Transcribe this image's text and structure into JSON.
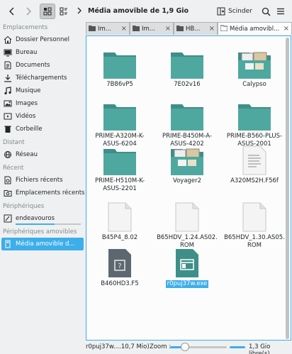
{
  "toolbar": {
    "back_icon": "chevron-left",
    "forward_icon": "chevron-right",
    "breadcrumb": "Média amovible de 1,9 Gio",
    "split_label": "Scinder"
  },
  "sidebar": {
    "sections": {
      "places": "Emplacements",
      "remote": "Distant",
      "recent": "Récent",
      "devices": "Périphériques",
      "removable": "Périphériques amovibles"
    },
    "places": [
      {
        "label": "Dossier Personnel",
        "icon": "home-icon"
      },
      {
        "label": "Bureau",
        "icon": "desktop-icon"
      },
      {
        "label": "Documents",
        "icon": "documents-icon"
      },
      {
        "label": "Téléchargements",
        "icon": "download-icon"
      },
      {
        "label": "Musique",
        "icon": "music-icon"
      },
      {
        "label": "Images",
        "icon": "images-icon"
      },
      {
        "label": "Vidéos",
        "icon": "video-icon"
      },
      {
        "label": "Corbeille",
        "icon": "trash-icon"
      }
    ],
    "remote": [
      {
        "label": "Réseau",
        "icon": "network-icon"
      }
    ],
    "recent": [
      {
        "label": "Fichiers récents",
        "icon": "recent-files-icon"
      },
      {
        "label": "Emplacements récents",
        "icon": "recent-places-icon"
      }
    ],
    "devices": [
      {
        "label": "endeavouros",
        "icon": "drive-icon"
      }
    ],
    "removable": [
      {
        "label": "Média amovible d...",
        "icon": "usb-drive-icon"
      }
    ]
  },
  "tabs": [
    {
      "label": "Im..."
    },
    {
      "label": "Im..."
    },
    {
      "label": "HB..."
    },
    {
      "label": "Média amovibl..."
    }
  ],
  "files": [
    {
      "name": "7B86vP5",
      "type": "folder"
    },
    {
      "name": "7E02v16",
      "type": "folder"
    },
    {
      "name": "Calypso",
      "type": "image-folder"
    },
    {
      "name": "PRIME-A320M-K-ASUS-6204",
      "type": "folder"
    },
    {
      "name": "PRIME-B450M-A-ASUS-4202",
      "type": "folder"
    },
    {
      "name": "PRIME-B560-PLUS-ASUS-2001",
      "type": "folder"
    },
    {
      "name": "PRIME-H510M-K-ASUS-2201",
      "type": "folder"
    },
    {
      "name": "Voyager2",
      "type": "image-folder"
    },
    {
      "name": "A320MS2H.F56f",
      "type": "text"
    },
    {
      "name": "B45P4_8.02",
      "type": "blank"
    },
    {
      "name": "B65HDV_1.24.AS02.ROM",
      "type": "blank"
    },
    {
      "name": "B65HDV_1.30.AS05.ROM",
      "type": "blank"
    },
    {
      "name": "B460HD3.F5",
      "type": "unknown"
    },
    {
      "name": "r0puj37w.exe",
      "type": "exe",
      "selected": true
    }
  ],
  "status": {
    "file_info": "r0puj37w....10,7 Mio)",
    "zoom_label": "Zoom :",
    "free_space": "1,3 Gio libre(s)"
  },
  "colors": {
    "accent": "#3daee9",
    "folder": "#4fa8a0",
    "folder_tab": "#3e8f88"
  }
}
